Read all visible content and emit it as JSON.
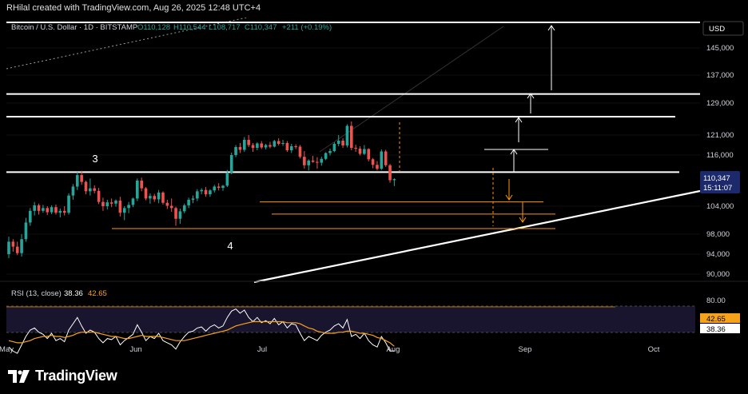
{
  "header": {
    "creator_text": "RHilal created with TradingView.com, Aug 26, 2025 12:48 UTC+4"
  },
  "legend": {
    "symbol": "Bitcoin / U.S. Dollar · 1D · BITSTAMP",
    "open": "O110,128",
    "high": "H110,544",
    "low": "L108,717",
    "close": "C110,347",
    "change": "+211 (+0.19%)"
  },
  "price_axis": {
    "currency": "USD",
    "current_price": "110,347",
    "countdown": "15:11:07"
  },
  "rsi": {
    "label": "RSI (13, close)",
    "value1": "38.36",
    "value2": "42.65",
    "tag_ma": "42.65",
    "tag_rsi": "38.36"
  },
  "annotations": {
    "wave_3": "3",
    "wave_4": "4"
  },
  "brand": {
    "name": "TradingView"
  },
  "colors": {
    "up": "#26a69a",
    "down": "#ef5350",
    "ma": "#f7a21b",
    "level": "#ff9800",
    "background": "#000000"
  },
  "chart_data": {
    "type": "candlestick",
    "x_tick_labels": [
      "May",
      "Jun",
      "Jul",
      "Aug",
      "Sep",
      "Oct"
    ],
    "y_tick_labels": [
      "145,000",
      "137,000",
      "129,000",
      "121,000",
      "116,000",
      "104,000",
      "98,000",
      "94,000",
      "90,000"
    ],
    "y_ticks": [
      145000,
      137000,
      129000,
      121000,
      116000,
      104000,
      98000,
      94000,
      90000
    ],
    "rsi_tick_labels": [
      "80.00"
    ],
    "resistance_levels": [
      131600,
      125600,
      112000
    ],
    "support_levels": [
      105000,
      102300,
      99200
    ],
    "candles": [
      [
        94000,
        97500,
        93200,
        96500
      ],
      [
        96500,
        97000,
        94500,
        95500
      ],
      [
        95500,
        96500,
        93800,
        94200
      ],
      [
        94200,
        98000,
        93500,
        97000
      ],
      [
        97000,
        101500,
        96500,
        100500
      ],
      [
        100500,
        103600,
        99800,
        103000
      ],
      [
        103000,
        105000,
        102000,
        104200
      ],
      [
        104200,
        104600,
        102200,
        103000
      ],
      [
        103000,
        104300,
        102600,
        103600
      ],
      [
        103600,
        104000,
        102100,
        102700
      ],
      [
        102700,
        104200,
        102300,
        103800
      ],
      [
        103800,
        104400,
        102200,
        102600
      ],
      [
        102600,
        103500,
        101600,
        103000
      ],
      [
        103000,
        104000,
        102000,
        102600
      ],
      [
        102600,
        107000,
        102200,
        106500
      ],
      [
        106500,
        109200,
        105500,
        108600
      ],
      [
        108600,
        112000,
        107800,
        111300
      ],
      [
        111300,
        112300,
        109000,
        109700
      ],
      [
        109700,
        110000,
        106800,
        107500
      ],
      [
        107500,
        110500,
        106500,
        108200
      ],
      [
        108200,
        108900,
        107000,
        107600
      ],
      [
        107600,
        108300,
        104500,
        105000
      ],
      [
        105000,
        106000,
        103000,
        104000
      ],
      [
        104000,
        105500,
        103300,
        104900
      ],
      [
        104900,
        105800,
        103800,
        104600
      ],
      [
        104600,
        105600,
        103900,
        105300
      ],
      [
        105300,
        106200,
        101800,
        102600
      ],
      [
        102600,
        104000,
        101000,
        103600
      ],
      [
        103600,
        105000,
        102500,
        104300
      ],
      [
        104300,
        106000,
        103800,
        105800
      ],
      [
        105800,
        110500,
        105200,
        110000
      ],
      [
        110000,
        110700,
        107500,
        108200
      ],
      [
        108200,
        108500,
        105400,
        105800
      ],
      [
        105800,
        107000,
        104600,
        106400
      ],
      [
        106400,
        106900,
        105000,
        105600
      ],
      [
        105600,
        107800,
        104700,
        107200
      ],
      [
        107200,
        107500,
        104400,
        104800
      ],
      [
        104800,
        105500,
        103400,
        104100
      ],
      [
        104100,
        105800,
        102800,
        103600
      ],
      [
        103600,
        103900,
        99800,
        101300
      ],
      [
        101300,
        103500,
        100200,
        102900
      ],
      [
        102900,
        104600,
        102500,
        104200
      ],
      [
        104200,
        106000,
        103600,
        105500
      ],
      [
        105500,
        106500,
        104700,
        105800
      ],
      [
        105800,
        108000,
        105200,
        107500
      ],
      [
        107500,
        108200,
        106800,
        107800
      ],
      [
        107800,
        108500,
        106200,
        106800
      ],
      [
        106800,
        108000,
        106200,
        107700
      ],
      [
        107700,
        109000,
        107200,
        108600
      ],
      [
        108600,
        109400,
        107700,
        108300
      ],
      [
        108300,
        109000,
        107600,
        108800
      ],
      [
        108800,
        112500,
        108500,
        111900
      ],
      [
        111900,
        116600,
        111500,
        116000
      ],
      [
        116000,
        118500,
        115500,
        118000
      ],
      [
        118000,
        119000,
        116500,
        117300
      ],
      [
        117300,
        120500,
        116800,
        119800
      ],
      [
        119800,
        121000,
        118000,
        118500
      ],
      [
        118500,
        119000,
        116800,
        117800
      ],
      [
        117800,
        119200,
        117200,
        118900
      ],
      [
        118900,
        119500,
        117500,
        117900
      ],
      [
        117900,
        118800,
        117400,
        118500
      ],
      [
        118500,
        119300,
        117700,
        118100
      ],
      [
        118100,
        119800,
        117900,
        119500
      ],
      [
        119500,
        120200,
        118400,
        118800
      ],
      [
        118800,
        119800,
        118300,
        119000
      ],
      [
        119000,
        119500,
        116800,
        117200
      ],
      [
        117200,
        118800,
        116500,
        118200
      ],
      [
        118200,
        118700,
        117500,
        118100
      ],
      [
        118100,
        118500,
        115200,
        115600
      ],
      [
        115600,
        117000,
        112800,
        113600
      ],
      [
        113600,
        115000,
        112400,
        114700
      ],
      [
        114700,
        115800,
        114200,
        114400
      ],
      [
        114400,
        115500,
        112800,
        114200
      ],
      [
        114200,
        115600,
        113500,
        115100
      ],
      [
        115100,
        116700,
        114800,
        116500
      ],
      [
        116500,
        117600,
        115900,
        117000
      ],
      [
        117000,
        119200,
        116700,
        118800
      ],
      [
        118800,
        121000,
        118200,
        119600
      ],
      [
        119600,
        120200,
        117800,
        118400
      ],
      [
        118400,
        123700,
        117900,
        123300
      ],
      [
        123300,
        124400,
        117200,
        117800
      ],
      [
        117800,
        118600,
        116800,
        117600
      ],
      [
        117600,
        118200,
        115900,
        116300
      ],
      [
        116300,
        118500,
        116000,
        117500
      ],
      [
        117500,
        117700,
        114500,
        115000
      ],
      [
        115000,
        115300,
        112900,
        113700
      ],
      [
        113700,
        114600,
        112400,
        112800
      ],
      [
        112800,
        117400,
        112500,
        116900
      ],
      [
        116900,
        117300,
        113200,
        113600
      ],
      [
        113600,
        113900,
        109500,
        110100
      ],
      [
        110100,
        110544,
        108717,
        110347
      ]
    ],
    "rsi_values": [
      42,
      38,
      36,
      44,
      52,
      58,
      60,
      56,
      54,
      50,
      55,
      48,
      50,
      47,
      58,
      64,
      70,
      62,
      55,
      58,
      56,
      50,
      46,
      50,
      49,
      52,
      44,
      48,
      51,
      54,
      63,
      56,
      48,
      52,
      50,
      55,
      48,
      46,
      44,
      40,
      47,
      52,
      56,
      57,
      60,
      61,
      57,
      61,
      63,
      60,
      62,
      70,
      76,
      78,
      74,
      77,
      70,
      66,
      70,
      65,
      67,
      64,
      69,
      63,
      66,
      60,
      64,
      63,
      55,
      48,
      52,
      50,
      48,
      53,
      56,
      58,
      62,
      64,
      60,
      68,
      52,
      54,
      50,
      55,
      48,
      44,
      42,
      52,
      46,
      38,
      38.36
    ],
    "rsi_ma_values": [
      48,
      47,
      46,
      46,
      47,
      48,
      50,
      51,
      52,
      52,
      53,
      52,
      52,
      51,
      52,
      53,
      55,
      56,
      56,
      56,
      56,
      55,
      54,
      53,
      52,
      52,
      51,
      50,
      50,
      51,
      52,
      53,
      52,
      52,
      52,
      52,
      51,
      50,
      49,
      48,
      48,
      48,
      49,
      50,
      51,
      52,
      53,
      54,
      55,
      56,
      57,
      58,
      60,
      62,
      63,
      64,
      65,
      66,
      66,
      66,
      66,
      66,
      66,
      66,
      66,
      65,
      65,
      65,
      64,
      62,
      60,
      59,
      57,
      56,
      55,
      55,
      55,
      56,
      56,
      57,
      57,
      56,
      55,
      55,
      54,
      53,
      51,
      50,
      48,
      46,
      42.65
    ]
  }
}
